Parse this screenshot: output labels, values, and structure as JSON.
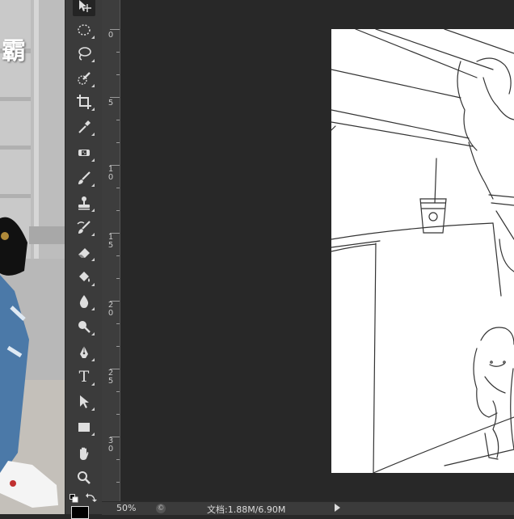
{
  "photo": {
    "title_text": "霸"
  },
  "tools": [
    {
      "name": "move-tool",
      "icon": "move-icon",
      "active": true
    },
    {
      "name": "elliptical-marquee-tool",
      "icon": "ellipse-marquee-icon"
    },
    {
      "name": "lasso-tool",
      "icon": "lasso-icon"
    },
    {
      "name": "quick-selection-tool",
      "icon": "quick-selection-icon"
    },
    {
      "name": "crop-tool",
      "icon": "crop-icon"
    },
    {
      "name": "eyedropper-tool",
      "icon": "eyedropper-icon"
    },
    {
      "name": "spot-healing-tool",
      "icon": "bandage-icon"
    },
    {
      "name": "brush-tool",
      "icon": "brush-icon"
    },
    {
      "name": "clone-stamp-tool",
      "icon": "stamp-icon"
    },
    {
      "name": "history-brush-tool",
      "icon": "history-brush-icon"
    },
    {
      "name": "eraser-tool",
      "icon": "eraser-icon"
    },
    {
      "name": "paint-bucket-tool",
      "icon": "paint-bucket-icon"
    },
    {
      "name": "blur-tool",
      "icon": "blur-drop-icon"
    },
    {
      "name": "dodge-tool",
      "icon": "dodge-icon"
    },
    {
      "name": "pen-tool",
      "icon": "pen-icon"
    },
    {
      "name": "type-tool",
      "icon": "type-icon",
      "label": "T"
    },
    {
      "name": "path-selection-tool",
      "icon": "arrow-cursor-icon"
    },
    {
      "name": "rectangle-tool",
      "icon": "rectangle-icon"
    },
    {
      "name": "hand-tool",
      "icon": "hand-icon"
    },
    {
      "name": "zoom-tool",
      "icon": "zoom-icon"
    }
  ],
  "ruler": {
    "labels": [
      "0",
      "5",
      "1\n0",
      "1\n5",
      "2\n0",
      "2\n5",
      "3\n0"
    ]
  },
  "status": {
    "zoom": "50%",
    "doc_size": "文档:1.88M/6.90M"
  },
  "colors": {
    "workspace": "#282828",
    "panel": "#3b3b3b",
    "canvas": "#ffffff"
  }
}
